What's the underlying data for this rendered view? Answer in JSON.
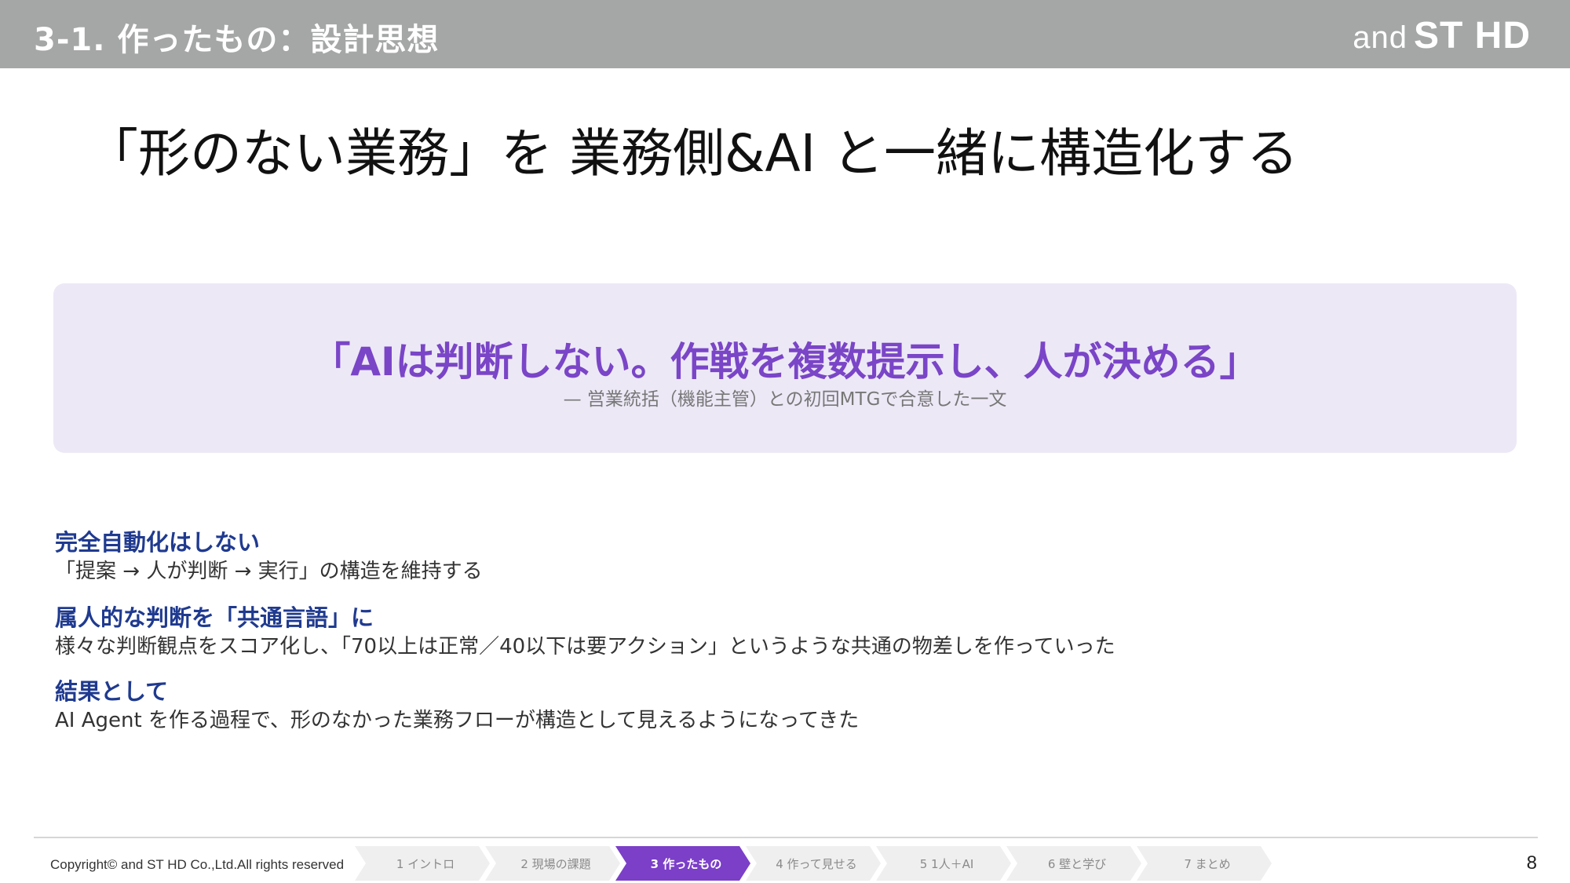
{
  "header": {
    "title": "3-1. 作ったもの：設計思想",
    "logo_and": "and",
    "logo_brand": "ST HD"
  },
  "headline": "「形のない業務」を 業務側&AI と一緒に構造化する",
  "quote": {
    "main": "「AIは判断しない。作戦を複数提示し、人が決める」",
    "sub": "— 営業統括（機能主管）との初回MTGで合意した一文"
  },
  "points": [
    {
      "title": "完全自動化はしない",
      "body": "「提案 → 人が判断 → 実行」の構造を維持する"
    },
    {
      "title": "属人的な判断を「共通言語」に",
      "body": "様々な判断観点をスコア化し、「70以上は正常／40以下は要アクション」というような共通の物差しを作っていった"
    },
    {
      "title": "結果として",
      "body": "AI Agent を作る過程で、形のなかった業務フローが構造として見えるようになってきた"
    }
  ],
  "footer": {
    "copyright": "Copyright© and ST HD Co.,Ltd.All rights reserved",
    "page_number": "8",
    "nav": [
      {
        "label": "1 イントロ",
        "active": false
      },
      {
        "label": "2 現場の課題",
        "active": false
      },
      {
        "label": "3 作ったもの",
        "active": true
      },
      {
        "label": "4 作って見せる",
        "active": false
      },
      {
        "label": "5 1人＋AI",
        "active": false
      },
      {
        "label": "6 壁と学び",
        "active": false
      },
      {
        "label": "7 まとめ",
        "active": false
      }
    ]
  },
  "colors": {
    "header_bg": "#a5a6a6",
    "accent_purple": "#7b3fc8",
    "heading_blue": "#1f3a8f",
    "quote_bg": "#ede8f6"
  }
}
